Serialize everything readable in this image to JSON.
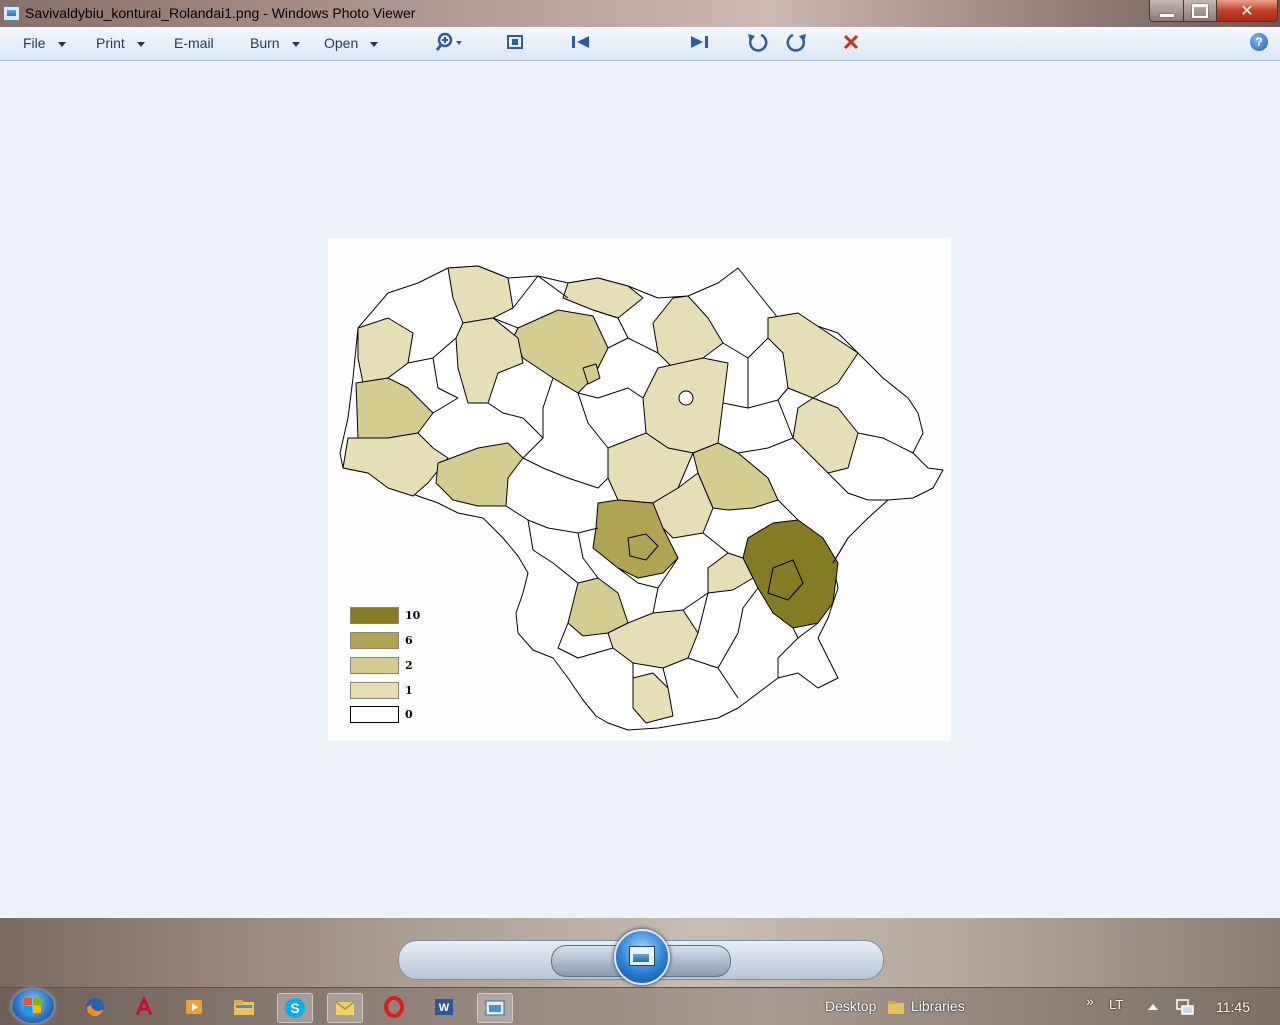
{
  "window": {
    "title": "Savivaldybiu_konturai_Rolandai1.png - Windows Photo Viewer",
    "app_icon": "photo-viewer-icon"
  },
  "menu": {
    "items": [
      {
        "label": "File",
        "dropdown": true
      },
      {
        "label": "Print",
        "dropdown": true
      },
      {
        "label": "E-mail",
        "dropdown": false
      },
      {
        "label": "Burn",
        "dropdown": true
      },
      {
        "label": "Open",
        "dropdown": true
      }
    ],
    "help": "?"
  },
  "map_legend": [
    {
      "label": "10",
      "color": "#857b22"
    },
    {
      "label": "6",
      "color": "#b0a452"
    },
    {
      "label": "2",
      "color": "#d5cc90"
    },
    {
      "label": "1",
      "color": "#e6dfb6"
    },
    {
      "label": "0",
      "color": "#ffffff"
    }
  ],
  "controls": [
    "zoom-icon",
    "actual-size-icon",
    "previous-icon",
    "slideshow-icon",
    "next-icon",
    "rotate-left-icon",
    "rotate-right-icon",
    "delete-icon"
  ],
  "taskbar": {
    "desktop_label": "Desktop",
    "libraries_label": "Libraries",
    "language": "LT",
    "time": "11:45",
    "chevron": "»"
  },
  "colors": {
    "accent": "#1e395b",
    "viewer_background": "#eef3fa",
    "close_button": "#c4412a"
  }
}
